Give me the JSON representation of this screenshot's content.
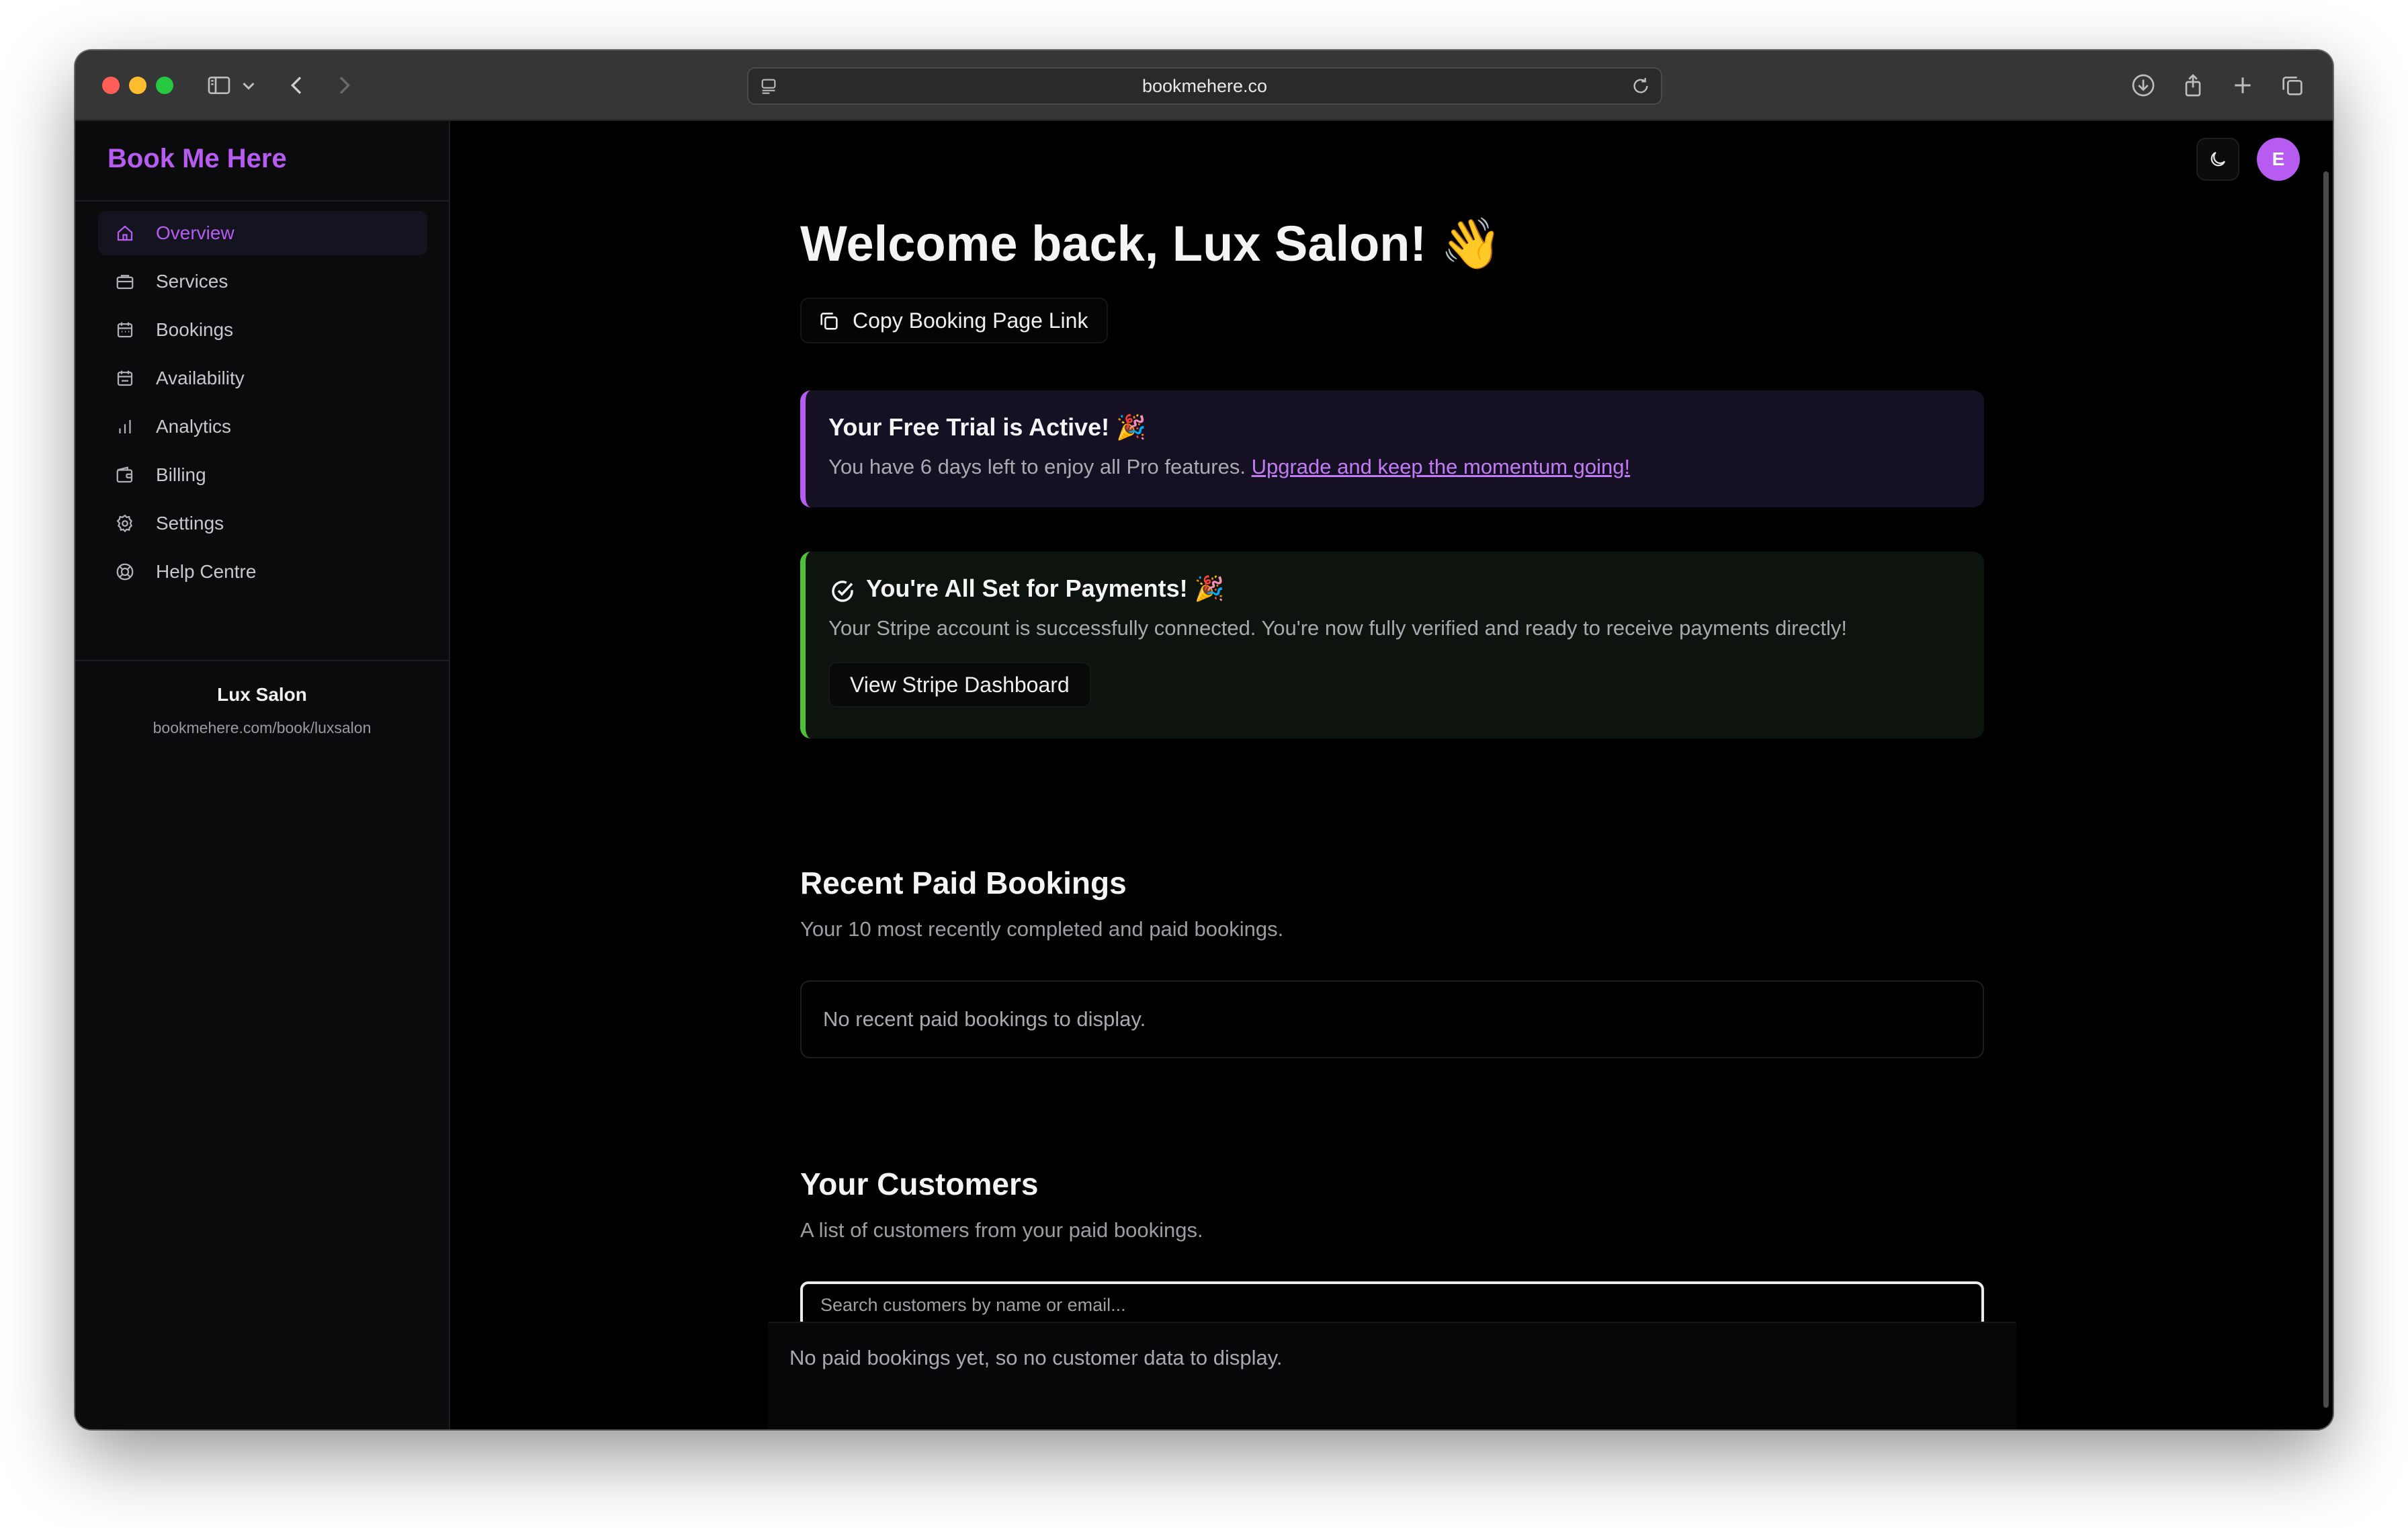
{
  "browser": {
    "url": "bookmehere.co"
  },
  "app": {
    "brand": "Book Me Here"
  },
  "sidebar": {
    "items": [
      {
        "label": "Overview",
        "icon": "home-icon",
        "active": true
      },
      {
        "label": "Services",
        "icon": "briefcase-icon",
        "active": false
      },
      {
        "label": "Bookings",
        "icon": "calendar-icon",
        "active": false
      },
      {
        "label": "Availability",
        "icon": "calendar-clock-icon",
        "active": false
      },
      {
        "label": "Analytics",
        "icon": "bar-chart-icon",
        "active": false
      },
      {
        "label": "Billing",
        "icon": "wallet-icon",
        "active": false
      },
      {
        "label": "Settings",
        "icon": "gear-icon",
        "active": false
      },
      {
        "label": "Help Centre",
        "icon": "lifebuoy-icon",
        "active": false
      }
    ],
    "business_name": "Lux Salon",
    "business_url": "bookmehere.com/book/luxsalon"
  },
  "header": {
    "avatar_initial": "E"
  },
  "main": {
    "welcome": "Welcome back, Lux Salon! 👋",
    "copy_link_label": "Copy Booking Page Link",
    "trial": {
      "title": "Your Free Trial is Active! 🎉",
      "text": "You have 6 days left to enjoy all Pro features.",
      "link": "Upgrade and keep the momentum going!"
    },
    "payments": {
      "title": "You're All Set for Payments! 🎉",
      "text": "Your Stripe account is successfully connected. You're now fully verified and ready to receive payments directly!",
      "button": "View Stripe Dashboard"
    },
    "recent": {
      "title": "Recent Paid Bookings",
      "subtitle": "Your 10 most recently completed and paid bookings.",
      "empty": "No recent paid bookings to display."
    },
    "customers": {
      "title": "Your Customers",
      "subtitle": "A list of customers from your paid bookings.",
      "search_placeholder": "Search customers by name or email...",
      "empty": "No paid bookings yet, so no customer data to display."
    }
  },
  "colors": {
    "accent": "#b65cf0",
    "success": "#4fbf3a",
    "background": "#000000"
  }
}
